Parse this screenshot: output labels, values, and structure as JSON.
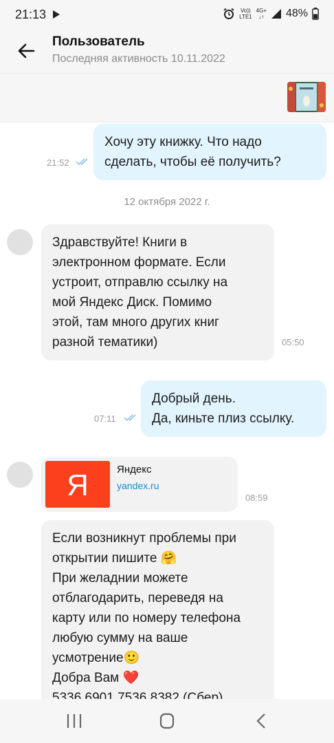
{
  "status_bar": {
    "time": "21:13",
    "network_top": "Vo))",
    "network_bottom": "LTE1",
    "net_type_top": "4G+",
    "net_type_bottom": "↓↑",
    "battery": "48%"
  },
  "header": {
    "title": "Пользователь",
    "subtitle": "Последняя активность 10.11.2022"
  },
  "pinned": {
    "thumb_icon": "book-cover-thumbnail"
  },
  "messages": {
    "m1": {
      "text": "Хочу эту книжку. Что надо\nсделать, чтобы её получить?",
      "time": "21:52"
    },
    "date_separator": "12 октября 2022 г.",
    "m2": {
      "text": "Здравствуйте! Книги в\nэлектронном формате. Если\nустроит, отправлю ссылку на\nмой Яндекс Диск. Помимо\nэтой, там много других книг\nразной тематики)",
      "time": "05:50"
    },
    "m3": {
      "text": "Добрый день.\nДа, киньте плиз ссылку.",
      "time": "07:11"
    },
    "link": {
      "title": "Яндекс",
      "url": "yandex.ru",
      "time": "08:59",
      "logo_letter": "Я"
    },
    "m4": {
      "text": "Если возникнут проблемы при\nоткрытии пишите 🤗\nПри желаднии можете\nотблагодарить, переведя на\nкарту или по номеру телефона\nлюбую сумму на ваше\nусмотрение🙂\nДобра Вам ❤️\n5336 6901 7536 8382 (Сбер)"
    }
  },
  "colors": {
    "outgoing_bubble": "#e2f4fd",
    "incoming_bubble": "#f2f2f2",
    "read_ticks": "#8fc3e6",
    "yandex_red": "#fc3f1d",
    "link_blue": "#1a8bc9"
  }
}
